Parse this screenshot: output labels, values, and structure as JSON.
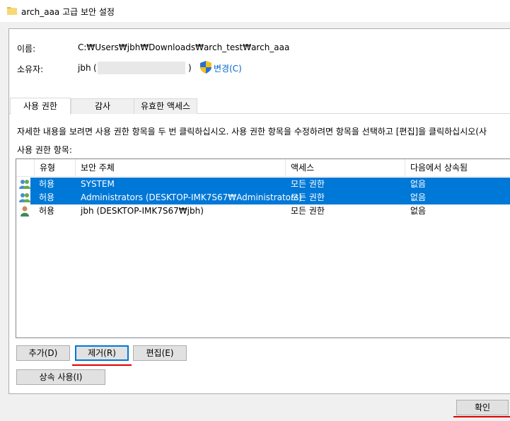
{
  "window": {
    "title": "arch_aaa 고급 보안 설정",
    "icon": "folder-icon"
  },
  "info": {
    "name_label": "이름:",
    "name_value": "C:₩Users₩jbh₩Downloads₩arch_test₩arch_aaa",
    "owner_label": "소유자:",
    "owner_value": "jbh",
    "owner_paren_open": "(",
    "owner_paren_close": ")",
    "change_label": "변경(C)"
  },
  "tabs": [
    {
      "label": "사용 권한"
    },
    {
      "label": "감사"
    },
    {
      "label": "유효한 액세스"
    }
  ],
  "description": "자세한 내용을 보려면 사용 권한 항목을 두 번 클릭하십시오. 사용 권한 항목을 수정하려면 항목을 선택하고 [편집]을 클릭하십시오(사",
  "list_label": "사용 권한 항목:",
  "columns": [
    "유형",
    "보안 주체",
    "액세스",
    "다음에서 상속됨"
  ],
  "entries": [
    {
      "type": "허용",
      "principal": "SYSTEM",
      "access": "모든 권한",
      "inherited": "없음",
      "selected": true,
      "icon": "group-icon"
    },
    {
      "type": "허용",
      "principal": "Administrators (DESKTOP-IMK7S67₩Administrators)",
      "access": "모든 권한",
      "inherited": "없음",
      "selected": true,
      "icon": "group-icon"
    },
    {
      "type": "허용",
      "principal": "jbh (DESKTOP-IMK7S67₩jbh)",
      "access": "모든 권한",
      "inherited": "없음",
      "selected": false,
      "icon": "user-icon"
    }
  ],
  "buttons": {
    "add": "추가(D)",
    "remove": "제거(R)",
    "edit": "편집(E)",
    "inherit": "상속 사용(I)",
    "ok": "확인"
  },
  "colors": {
    "selection": "#0078d7",
    "link": "#0066cc",
    "highlight_underline": "#e00000"
  }
}
